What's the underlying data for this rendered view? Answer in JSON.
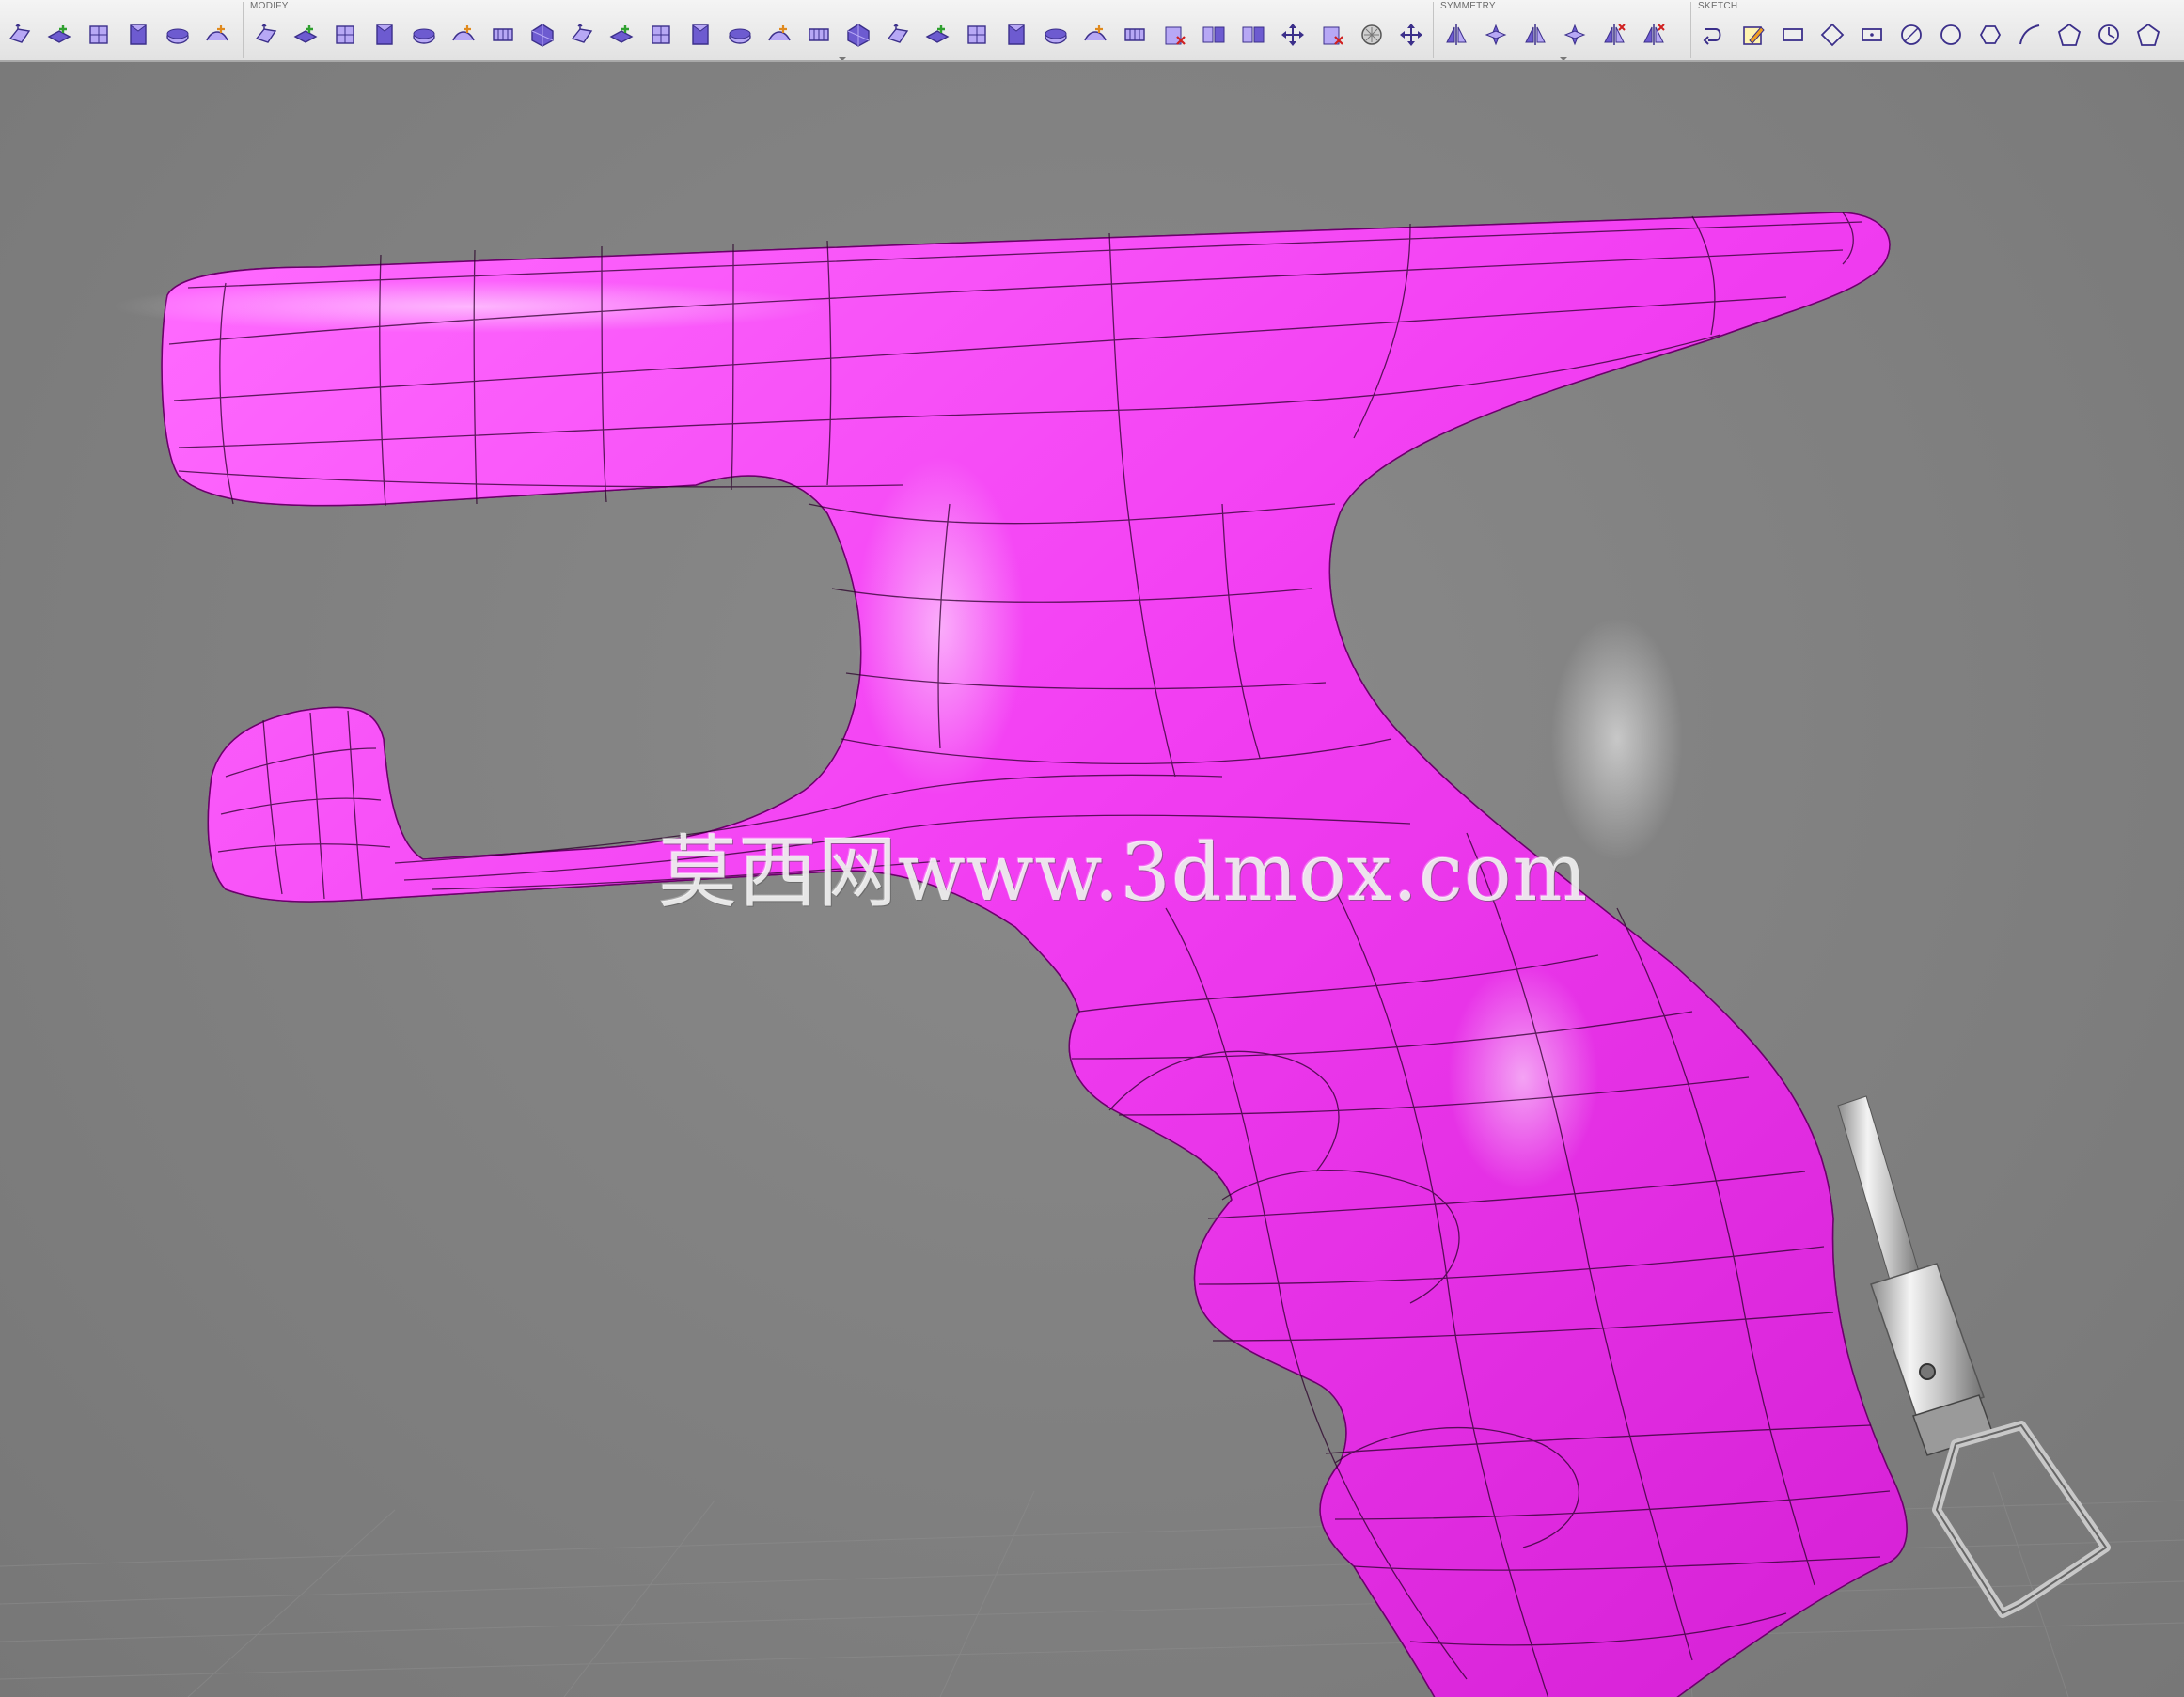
{
  "toolbar": {
    "groups": [
      {
        "id": "create",
        "label": "",
        "icons": [
          "extrude-icon",
          "sweep-icon",
          "box-icon",
          "cylinder-icon",
          "sphere-icon",
          "torus-icon"
        ]
      },
      {
        "id": "modify",
        "label": "MODIFY",
        "icons": [
          "edit-form-icon",
          "insert-edge-icon",
          "subdivide-icon",
          "insert-point-icon",
          "merge-edge-icon",
          "bridge-icon",
          "fill-hole-icon",
          "weld-vertices-icon",
          "unweld-edges-icon",
          "crease-icon",
          "uncrease-icon",
          "bevel-edge-icon",
          "slide-edge-icon",
          "pull-icon",
          "flatten-icon",
          "match-icon",
          "interpolate-icon",
          "thicken-icon",
          "freeze-icon",
          "unfreeze-icon",
          "make-uniform-icon",
          "convert-icon",
          "repair-body-icon",
          "delete-icon",
          "combine-icon",
          "split-body-icon",
          "move-icon",
          "erase-icon",
          "display-mode-icon",
          "remove-icon"
        ]
      },
      {
        "id": "symmetry",
        "label": "SYMMETRY",
        "icons": [
          "mirror-internal-icon",
          "circular-internal-icon",
          "mirror-duplicate-icon",
          "circular-duplicate-icon",
          "clear-symmetry-icon",
          "isolate-symmetry-icon"
        ]
      },
      {
        "id": "sketch",
        "label": "SKETCH",
        "icons": [
          "line-icon",
          "create-sketch-icon",
          "rectangle-icon",
          "diamond-icon",
          "center-rectangle-icon",
          "circle-diameter-icon",
          "circle-icon",
          "polygon-icon",
          "arc-icon",
          "pentagon-icon",
          "clock-icon",
          "house-icon"
        ]
      }
    ]
  },
  "viewport": {
    "watermark": "莫西网www.3dmox.com",
    "model_color": "#ff33ff",
    "background_color": "#808080"
  }
}
